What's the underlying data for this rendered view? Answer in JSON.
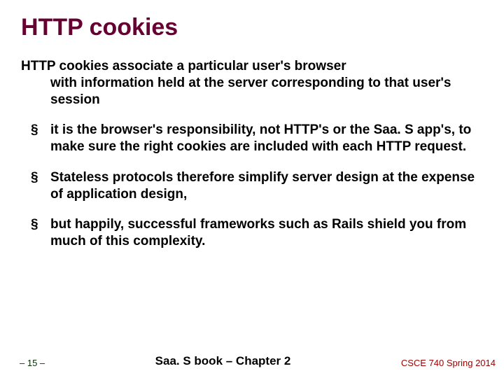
{
  "title": "HTTP cookies",
  "intro_first": "HTTP cookies associate a particular user's browser",
  "intro_rest": "with information held at the server corresponding to that user's session",
  "bullets": [
    "it is the browser's responsibility, not HTTP's or the Saa. S app's, to make sure the right cookies are included with each HTTP request.",
    "Stateless protocols therefore simplify server design at the expense of application design,",
    "but happily, successful frameworks such as Rails shield you from much of this complexity."
  ],
  "footer": {
    "page": "– 15 –",
    "center": "Saa. S book – Chapter 2",
    "right": "CSCE 740 Spring 2014"
  }
}
